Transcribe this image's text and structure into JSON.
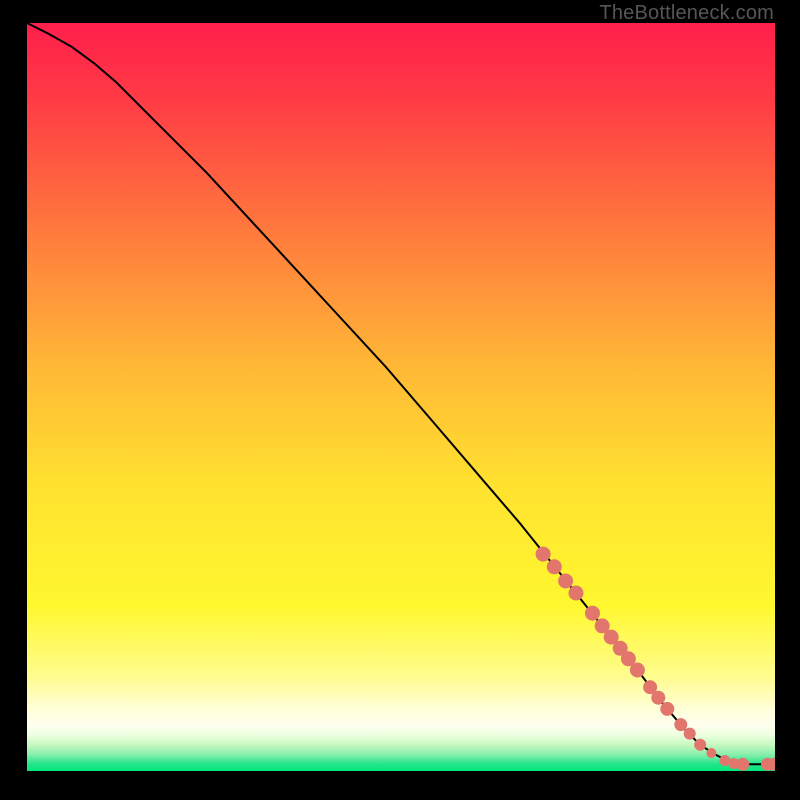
{
  "watermark": "TheBottleneck.com",
  "chart_data": {
    "type": "line",
    "title": "",
    "xlabel": "",
    "ylabel": "",
    "xlim": [
      0,
      100
    ],
    "ylim": [
      0,
      100
    ],
    "grid": false,
    "series": [
      {
        "name": "curve",
        "x": [
          0,
          3,
          6,
          9,
          12,
          18,
          24,
          30,
          36,
          42,
          48,
          54,
          60,
          66,
          72,
          78,
          82,
          85,
          88,
          90,
          92,
          94,
          95.5,
          98,
          100
        ],
        "y": [
          100,
          98.5,
          96.8,
          94.6,
          92,
          86,
          80,
          73.5,
          67,
          60.5,
          54,
          47,
          40,
          33,
          25.5,
          18,
          13,
          9,
          5.5,
          3.5,
          2.2,
          1.2,
          0.9,
          0.9,
          0.9
        ]
      }
    ],
    "markers": [
      {
        "x": 69.0,
        "y": 29.0,
        "r": 7.5
      },
      {
        "x": 70.5,
        "y": 27.3,
        "r": 7.5
      },
      {
        "x": 72.0,
        "y": 25.4,
        "r": 7.5
      },
      {
        "x": 73.4,
        "y": 23.8,
        "r": 7.5
      },
      {
        "x": 75.6,
        "y": 21.1,
        "r": 7.5
      },
      {
        "x": 76.9,
        "y": 19.4,
        "r": 7.5
      },
      {
        "x": 78.1,
        "y": 17.9,
        "r": 7.5
      },
      {
        "x": 79.3,
        "y": 16.4,
        "r": 7.5
      },
      {
        "x": 80.4,
        "y": 15.0,
        "r": 7.5
      },
      {
        "x": 81.6,
        "y": 13.5,
        "r": 7.5
      },
      {
        "x": 83.3,
        "y": 11.2,
        "r": 7.0
      },
      {
        "x": 84.4,
        "y": 9.8,
        "r": 7.0
      },
      {
        "x": 85.6,
        "y": 8.3,
        "r": 7.0
      },
      {
        "x": 87.4,
        "y": 6.2,
        "r": 6.5
      },
      {
        "x": 88.6,
        "y": 5.0,
        "r": 6.0
      },
      {
        "x": 90.0,
        "y": 3.5,
        "r": 6.0
      },
      {
        "x": 91.5,
        "y": 2.4,
        "r": 5.0
      },
      {
        "x": 93.3,
        "y": 1.4,
        "r": 5.5
      },
      {
        "x": 94.5,
        "y": 1.0,
        "r": 5.5
      },
      {
        "x": 95.7,
        "y": 0.9,
        "r": 6.5
      },
      {
        "x": 99.0,
        "y": 0.9,
        "r": 6.5
      },
      {
        "x": 100.0,
        "y": 0.9,
        "r": 6.5
      }
    ],
    "colors": {
      "gradient_top": "#ff1f4b",
      "gradient_mid_upper": "#ff8a3a",
      "gradient_mid": "#ffec2c",
      "gradient_lower": "#fffc9a",
      "gradient_band": "#b6f7b0",
      "gradient_bottom": "#00e67a",
      "marker": "#e2766c",
      "curve": "#000000"
    }
  }
}
